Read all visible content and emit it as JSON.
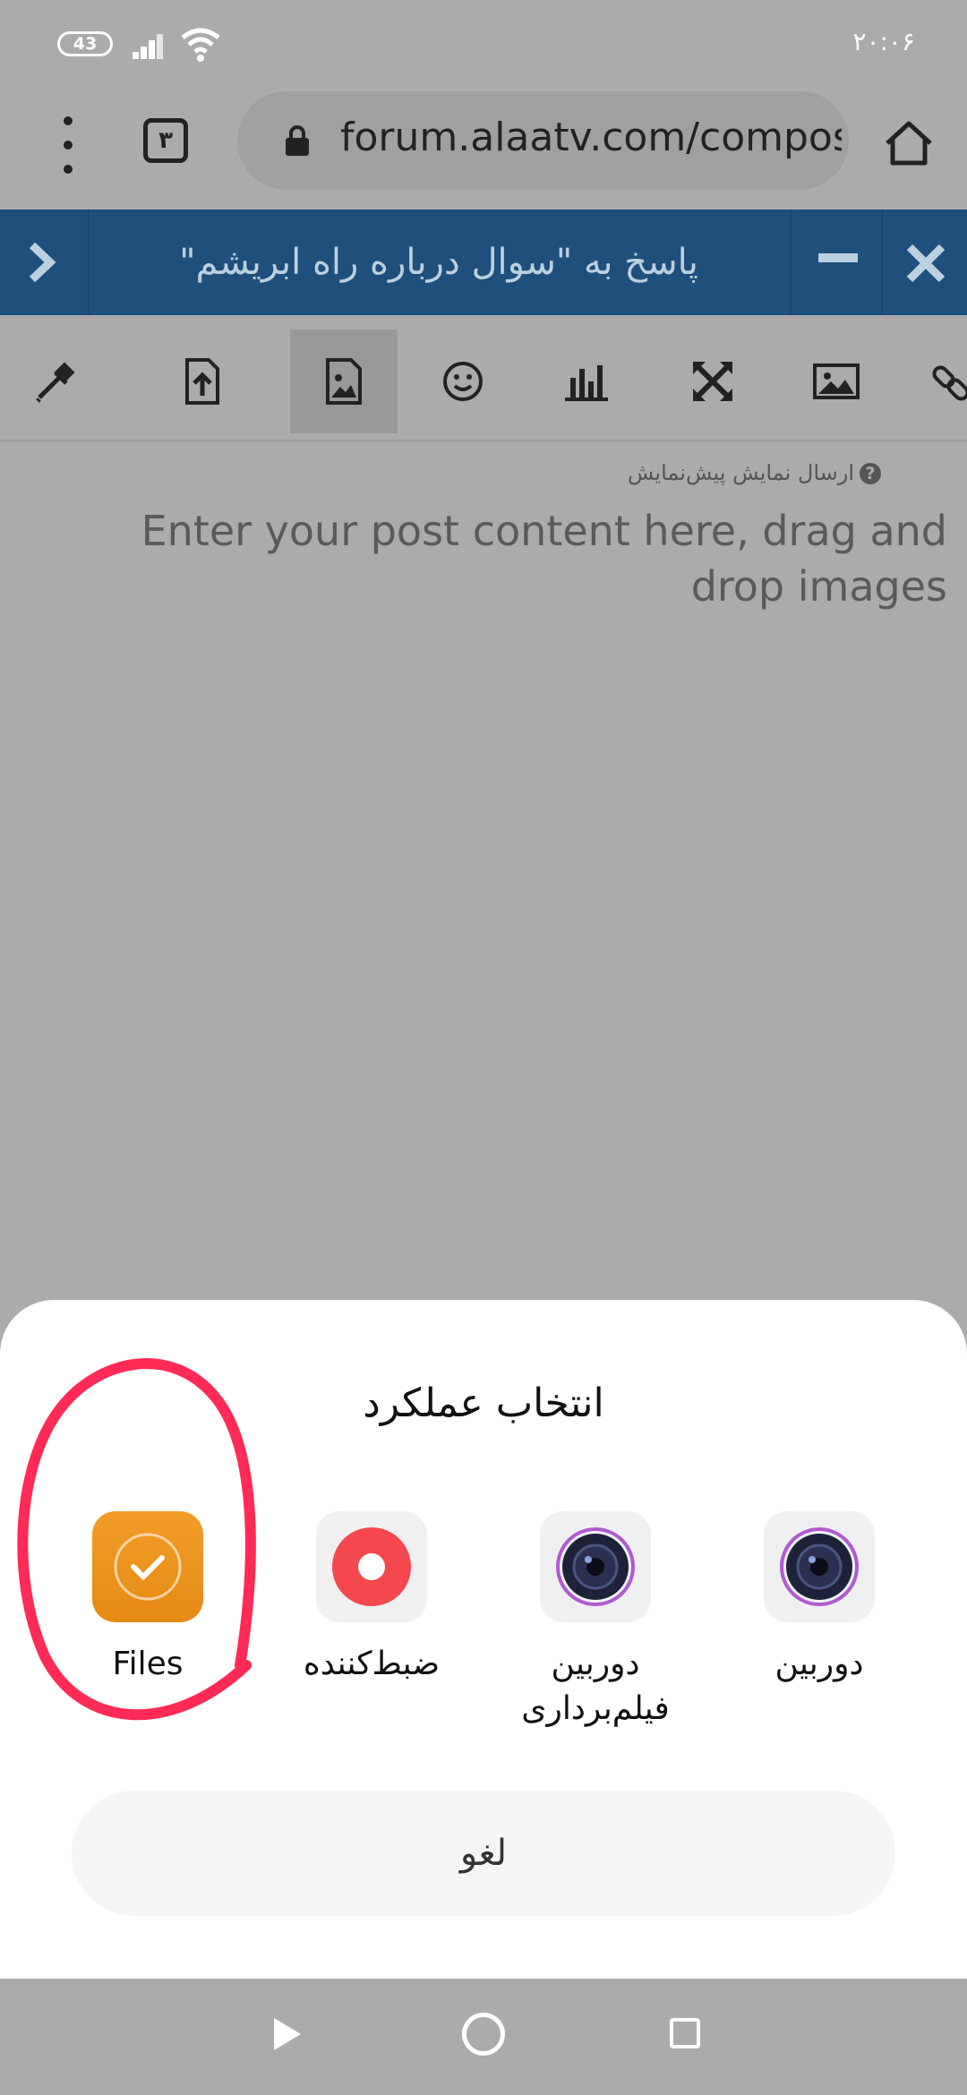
{
  "status_bar": {
    "battery": "43",
    "time": "۲۰:۰۶"
  },
  "browser": {
    "tab_count": "۳",
    "url": "forum.alaatv.com/compos"
  },
  "composer": {
    "title": "پاسخ به \"سوال درباره راه ابریشم\""
  },
  "toolbar": {
    "icons": [
      "eyedropper-icon",
      "file-upload-icon",
      "image-upload-icon",
      "emoji-icon",
      "chart-icon",
      "fullscreen-icon",
      "image-icon",
      "link-icon"
    ]
  },
  "editor": {
    "preview_line": "ارسال نمایش پیش‌نمایش",
    "help_mark": "?",
    "placeholder": "Enter your post content here, drag and drop images"
  },
  "sheet": {
    "title": "انتخاب عملکرد",
    "options": [
      {
        "label": "Files",
        "icon": "files-check-icon",
        "color": "#ee961f"
      },
      {
        "label": "ضبط‌کننده",
        "icon": "recorder-icon",
        "color": "#f4474e"
      },
      {
        "label": "دوربین فیلم‌برداری",
        "icon": "video-camera-icon"
      },
      {
        "label": "دوربین",
        "icon": "camera-icon"
      }
    ],
    "cancel": "لغو",
    "annotation_color": "#ff2a55"
  }
}
